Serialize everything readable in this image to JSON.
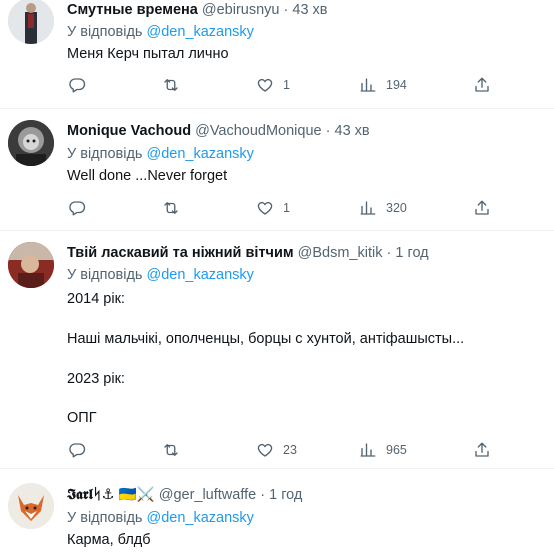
{
  "tweets": [
    {
      "name": "Смутные времена",
      "handle": "@ebirusnyu",
      "time": "43 хв",
      "reply_prefix": "У відповідь",
      "reply_to": "@den_kazansky",
      "lines": [
        "Меня Керч пытал лично"
      ],
      "replies": "",
      "retweets": "",
      "likes": "1",
      "views": "194"
    },
    {
      "name": "Monique Vachoud",
      "handle": "@VachoudMonique",
      "time": "43 хв",
      "reply_prefix": "У відповідь",
      "reply_to": "@den_kazansky",
      "lines": [
        "Well done ...Never forget"
      ],
      "replies": "",
      "retweets": "",
      "likes": "1",
      "views": "320"
    },
    {
      "name": "Твій ласкавий та ніжний вітчим",
      "handle": "@Bdsm_kitik",
      "time": "1 год",
      "reply_prefix": "У відповідь",
      "reply_to": "@den_kazansky",
      "lines": [
        "2014 рік:",
        "Наші мальчікі, ополченцы, борцы с хунтой, антіфашысты...",
        "2023 рік:",
        "ОПГ"
      ],
      "replies": "",
      "retweets": "",
      "likes": "23",
      "views": "965"
    },
    {
      "name": "𝕴𝖆𝖗𝖑ᛋ⚓ 🇺🇦⚔️",
      "handle": "@ger_luftwaffe",
      "time": "1 год",
      "reply_prefix": "У відповідь",
      "reply_to": "@den_kazansky",
      "lines": [
        "Карма, блдб"
      ]
    }
  ],
  "separator": "·",
  "icons": [
    "reply-icon",
    "retweet-icon",
    "like-icon",
    "views-icon",
    "share-icon"
  ]
}
